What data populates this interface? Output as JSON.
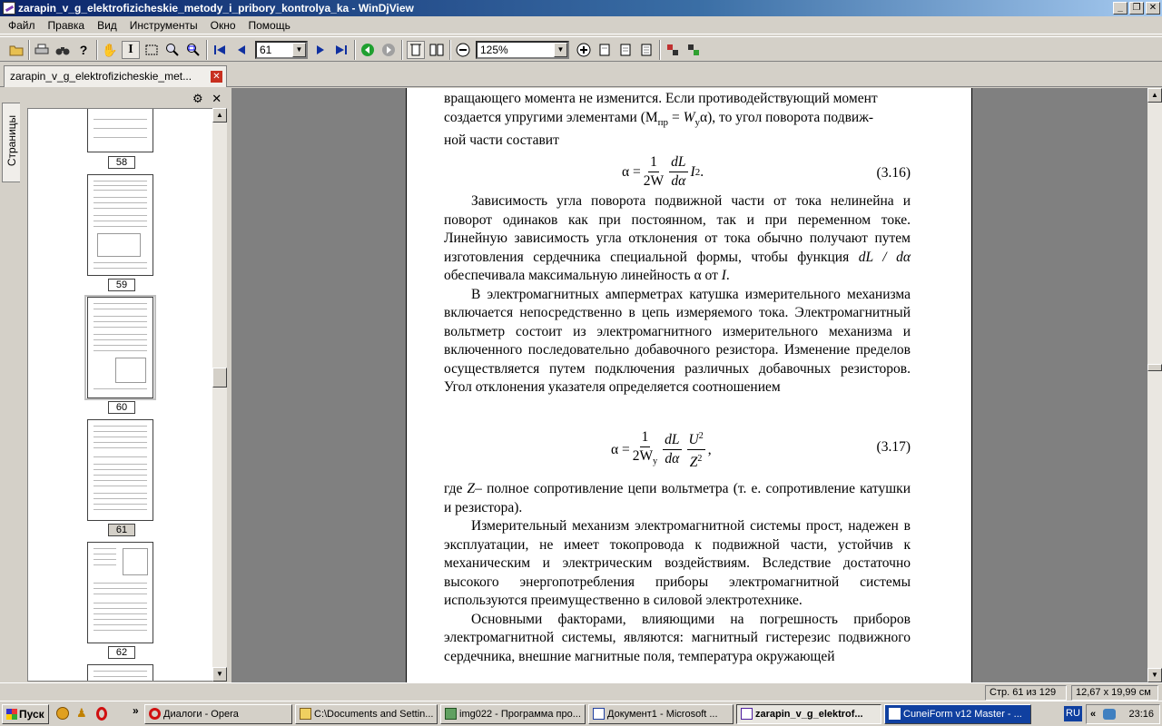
{
  "window": {
    "title": "zarapin_v_g_elektrofizicheskie_metody_i_pribory_kontrolya_ka - WinDjView"
  },
  "menu": [
    "Файл",
    "Правка",
    "Вид",
    "Инструменты",
    "Окно",
    "Помощь"
  ],
  "toolbar": {
    "page_value": "61",
    "zoom_value": "125%"
  },
  "tab": {
    "label": "zarapin_v_g_elektrofizicheskie_met..."
  },
  "sidebar": {
    "tab_label": "Страницы",
    "thumbs": [
      "58",
      "59",
      "60",
      "61",
      "62"
    ]
  },
  "document": {
    "line1": "вращающего момента не изменится. Если противодействующий момент",
    "line2a": "создается упругими элементами (M",
    "line2sub": "пр",
    "line2b": " = ",
    "line2W": "W",
    "line2Wsub": "y",
    "line2c": "α), то угол поворота подвиж-",
    "line3": "ной части составит",
    "f1": {
      "lhs": "α =",
      "num": "1",
      "den": "2W",
      "num2": "dL",
      "den2": "dα",
      "tail": "I",
      "sup": "2",
      "dot": ".",
      "label": "(3.16)"
    },
    "p2": "Зависимость угла поворота подвижной части от тока нелинейна и поворот одинаков как при постоянном, так и при переменном токе. Линейную зависимость угла отклонения от тока обычно получают путем изготовления сердечника специальной формы, чтобы функция",
    "p2i": "dL / dα",
    "p2tail": " обеспечивала максимальную линейность α от ",
    "p2I": "I",
    "p2end": ".",
    "p3": "В электромагнитных амперметрах катушка измерительного механизма включается непосредственно в цепь измеряемого тока. Электромагнитный вольтметр состоит из электромагнитного измерительного механизма и включенного последовательно добавочного резистора. Изменение пределов осуществляется путем подключения различных добавочных резисторов. Угол отклонения указателя определяется соотношением",
    "f2": {
      "lhs": "α =",
      "num": "1",
      "den": "2W",
      "densub": "y",
      "num2": "dL",
      "den2": "dα",
      "num3": "U",
      "num3sup": "2",
      "den3": "Z",
      "den3sup": "2",
      "comma": ",",
      "label": "(3.17)"
    },
    "p4a": "где ",
    "p4Z": "Z",
    "p4b": "– полное сопротивление цепи вольтметра (т. е. сопротивление катушки и резистора).",
    "p5": "Измерительный механизм электромагнитной системы прост, надежен в эксплуатации, не имеет токопровода к подвижной части, устойчив к механическим и электрическим воздействиям. Вследствие достаточно высокого энергопотребления приборы электромагнитной системы используются преимущественно в силовой электротехнике.",
    "p6": "Основными факторами, влияющими на погрешность приборов электромагнитной системы, являются: магнитный гистерезис подвижного сердечника, внешние магнитные поля, температура окружающей"
  },
  "status": {
    "page": "Стр. 61 из 129",
    "size": "12,67 x 19,99 см"
  },
  "taskbar": {
    "start": "Пуск",
    "tasks": [
      "Диалоги - Opera",
      "C:\\Documents and Settin...",
      "img022 - Программа про...",
      "Документ1 - Microsoft ...",
      "zarapin_v_g_elektrof...",
      "CuneiForm v12 Master - ..."
    ],
    "lang": "RU",
    "clock": "23:16"
  }
}
